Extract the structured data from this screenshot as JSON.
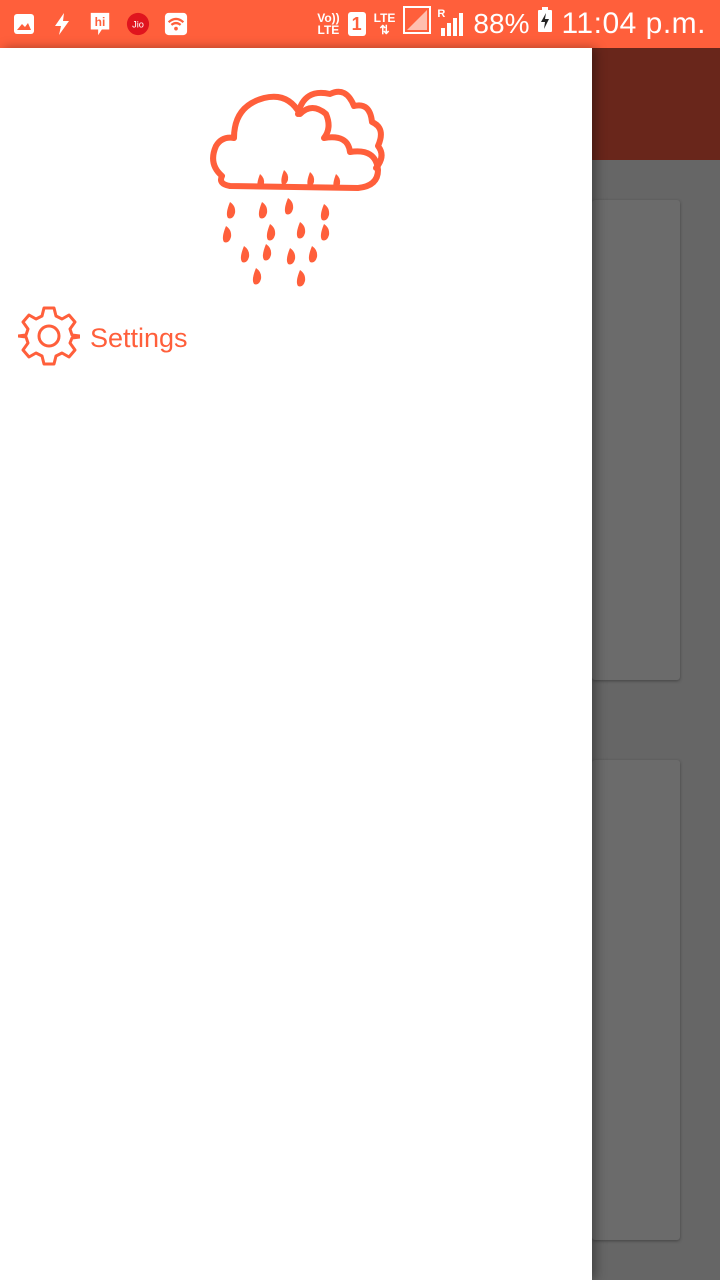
{
  "status_bar": {
    "volte_label_top": "Vo))",
    "volte_label_bottom": "LTE",
    "sim_slot": "1",
    "lte_label": "LTE",
    "roaming_label": "R",
    "battery_percent": "88%",
    "time": "11:04 p.m.",
    "icons": [
      "gallery-icon",
      "flash-icon",
      "hike-icon",
      "jio-icon",
      "wifi-icon",
      "signal-icon",
      "battery-charging-icon"
    ],
    "jio_text": "Jio",
    "hike_text": "hi"
  },
  "drawer": {
    "logo_icon": "rain-cloud-icon",
    "menu": [
      {
        "label": "Settings",
        "icon": "gear-icon"
      }
    ]
  },
  "colors": {
    "accent": "#ff5f3b",
    "app_bar_dimmed": "#69261b",
    "scrim": "#666666"
  }
}
